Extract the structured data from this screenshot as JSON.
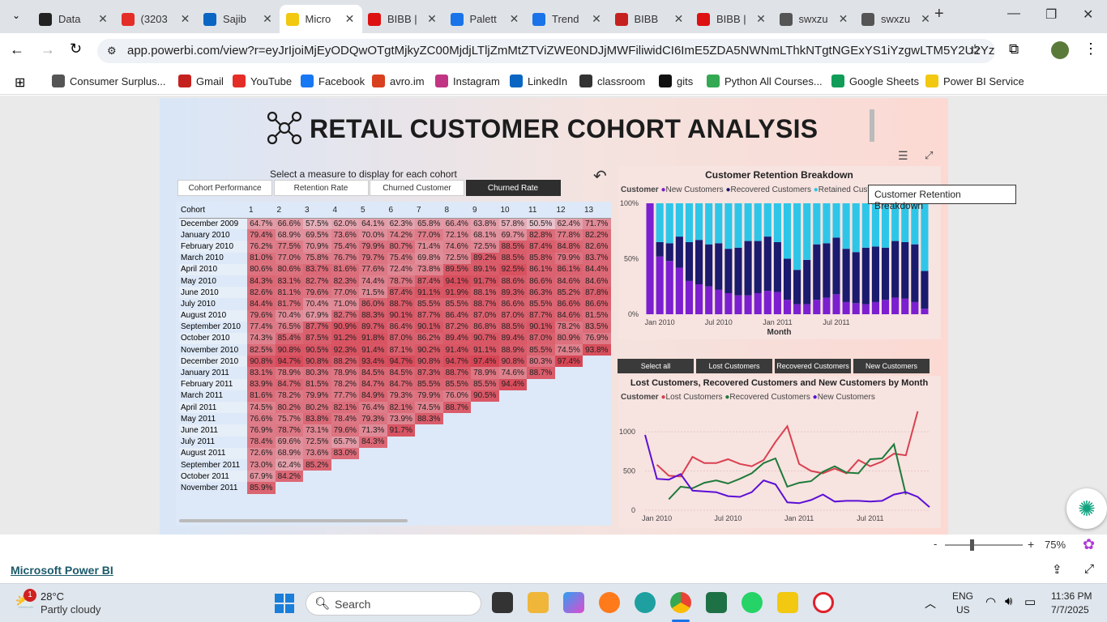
{
  "browser": {
    "tabs": [
      {
        "label": "Data",
        "color": "#222"
      },
      {
        "label": "(3203",
        "color": "#e52d27"
      },
      {
        "label": "Sajib",
        "color": "#0a66c2"
      },
      {
        "label": "Micro",
        "color": "#f2c811"
      },
      {
        "label": "BIBB |",
        "color": "#d11"
      },
      {
        "label": "Palett",
        "color": "#1a73e8"
      },
      {
        "label": "Trend",
        "color": "#1a73e8"
      },
      {
        "label": "BIBB",
        "color": "#c5221f"
      },
      {
        "label": "BIBB |",
        "color": "#d11"
      },
      {
        "label": "swxzu",
        "color": "#555"
      },
      {
        "label": "swxzu",
        "color": "#555"
      }
    ],
    "url": "app.powerbi.com/view?r=eyJrIjoiMjEyODQwOTgtMjkyZC00MjdjLTljZmMtZTViZWE0NDJjMWFiliwidCI6ImE5ZDA5NWNmLThkNTgtNGExYS1iYzgwLTM5Y2U2YzNjMGNj...",
    "bookmarks": [
      {
        "label": "Consumer Surplus...",
        "color": "#555"
      },
      {
        "label": "Gmail",
        "color": "#c5221f"
      },
      {
        "label": "YouTube",
        "color": "#e52d27"
      },
      {
        "label": "Facebook",
        "color": "#1877f2"
      },
      {
        "label": "avro.im",
        "color": "#d9401f"
      },
      {
        "label": "Instagram",
        "color": "#c13584"
      },
      {
        "label": "LinkedIn",
        "color": "#0a66c2"
      },
      {
        "label": "classroom",
        "color": "#333"
      },
      {
        "label": "gits",
        "color": "#111"
      },
      {
        "label": "Python All Courses...",
        "color": "#34a853"
      },
      {
        "label": "Google Sheets",
        "color": "#0f9d58"
      },
      {
        "label": "Power BI Service",
        "color": "#f2c811"
      }
    ]
  },
  "report": {
    "title": "RETAIL CUSTOMER COHORT ANALYSIS",
    "measure_prompt": "Select a measure to display for each cohort",
    "measure_buttons": [
      "Cohort Performance",
      "Retention Rate",
      "Churned Customer",
      "Churned Rate"
    ],
    "selected_measure": "Churned Rate",
    "cohort_header": "Cohort",
    "month_headers": [
      "1",
      "2",
      "3",
      "4",
      "5",
      "6",
      "7",
      "8",
      "9",
      "10",
      "11",
      "12",
      "13"
    ],
    "cohorts": [
      {
        "name": "December 2009",
        "values": [
          "64.7%",
          "66.6%",
          "57.5%",
          "62.0%",
          "64.1%",
          "62.3%",
          "65.8%",
          "66.4%",
          "63.8%",
          "57.8%",
          "50.5%",
          "62.4%",
          "71.7%"
        ]
      },
      {
        "name": "January 2010",
        "values": [
          "79.4%",
          "68.9%",
          "69.5%",
          "73.6%",
          "70.0%",
          "74.2%",
          "77.0%",
          "72.1%",
          "68.1%",
          "69.7%",
          "82.8%",
          "77.8%",
          "82.2%"
        ]
      },
      {
        "name": "February 2010",
        "values": [
          "76.2%",
          "77.5%",
          "70.9%",
          "75.4%",
          "79.9%",
          "80.7%",
          "71.4%",
          "74.6%",
          "72.5%",
          "88.5%",
          "87.4%",
          "84.8%",
          "82.6%"
        ]
      },
      {
        "name": "March 2010",
        "values": [
          "81.0%",
          "77.0%",
          "75.8%",
          "76.7%",
          "79.7%",
          "75.4%",
          "69.8%",
          "72.5%",
          "89.2%",
          "88.5%",
          "85.8%",
          "79.9%",
          "83.7%"
        ]
      },
      {
        "name": "April 2010",
        "values": [
          "80.6%",
          "80.6%",
          "83.7%",
          "81.6%",
          "77.6%",
          "72.4%",
          "73.8%",
          "89.5%",
          "89.1%",
          "92.5%",
          "86.1%",
          "86.1%",
          "84.4%"
        ]
      },
      {
        "name": "May 2010",
        "values": [
          "84.3%",
          "83.1%",
          "82.7%",
          "82.3%",
          "74.4%",
          "78.7%",
          "87.4%",
          "94.1%",
          "91.7%",
          "88.6%",
          "86.6%",
          "84.6%",
          "84.6%"
        ]
      },
      {
        "name": "June 2010",
        "values": [
          "82.6%",
          "81.1%",
          "79.6%",
          "77.0%",
          "71.5%",
          "87.4%",
          "91.1%",
          "91.9%",
          "88.1%",
          "89.3%",
          "86.3%",
          "85.2%",
          "87.8%"
        ]
      },
      {
        "name": "July 2010",
        "values": [
          "84.4%",
          "81.7%",
          "70.4%",
          "71.0%",
          "86.0%",
          "88.7%",
          "85.5%",
          "85.5%",
          "88.7%",
          "86.6%",
          "85.5%",
          "86.6%",
          "86.6%"
        ]
      },
      {
        "name": "August 2010",
        "values": [
          "79.6%",
          "70.4%",
          "67.9%",
          "82.7%",
          "88.3%",
          "90.1%",
          "87.7%",
          "86.4%",
          "87.0%",
          "87.0%",
          "87.7%",
          "84.6%",
          "81.5%"
        ]
      },
      {
        "name": "September 2010",
        "values": [
          "77.4%",
          "76.5%",
          "87.7%",
          "90.9%",
          "89.7%",
          "86.4%",
          "90.1%",
          "87.2%",
          "86.8%",
          "88.5%",
          "90.1%",
          "78.2%",
          "83.5%"
        ]
      },
      {
        "name": "October 2010",
        "values": [
          "74.3%",
          "85.4%",
          "87.5%",
          "91.2%",
          "91.8%",
          "87.0%",
          "86.2%",
          "89.4%",
          "90.7%",
          "89.4%",
          "87.0%",
          "80.9%",
          "76.9%"
        ]
      },
      {
        "name": "November 2010",
        "values": [
          "82.5%",
          "90.8%",
          "90.5%",
          "92.3%",
          "91.4%",
          "87.1%",
          "90.2%",
          "91.4%",
          "91.1%",
          "88.9%",
          "85.5%",
          "74.5%",
          "93.8%"
        ]
      },
      {
        "name": "December 2010",
        "values": [
          "90.8%",
          "94.7%",
          "90.8%",
          "88.2%",
          "93.4%",
          "94.7%",
          "90.8%",
          "94.7%",
          "97.4%",
          "90.8%",
          "80.3%",
          "97.4%",
          ""
        ]
      },
      {
        "name": "January 2011",
        "values": [
          "83.1%",
          "78.9%",
          "80.3%",
          "78.9%",
          "84.5%",
          "84.5%",
          "87.3%",
          "88.7%",
          "78.9%",
          "74.6%",
          "88.7%",
          "",
          ""
        ]
      },
      {
        "name": "February 2011",
        "values": [
          "83.9%",
          "84.7%",
          "81.5%",
          "78.2%",
          "84.7%",
          "84.7%",
          "85.5%",
          "85.5%",
          "85.5%",
          "94.4%",
          "",
          "",
          ""
        ]
      },
      {
        "name": "March 2011",
        "values": [
          "81.6%",
          "78.2%",
          "79.9%",
          "77.7%",
          "84.9%",
          "79.3%",
          "79.9%",
          "76.0%",
          "90.5%",
          "",
          "",
          "",
          ""
        ]
      },
      {
        "name": "April 2011",
        "values": [
          "74.5%",
          "80.2%",
          "80.2%",
          "82.1%",
          "76.4%",
          "82.1%",
          "74.5%",
          "88.7%",
          "",
          "",
          "",
          "",
          ""
        ]
      },
      {
        "name": "May 2011",
        "values": [
          "76.6%",
          "75.7%",
          "83.8%",
          "78.4%",
          "79.3%",
          "73.9%",
          "88.3%",
          "",
          "",
          "",
          "",
          "",
          ""
        ]
      },
      {
        "name": "June 2011",
        "values": [
          "76.9%",
          "78.7%",
          "73.1%",
          "79.6%",
          "71.3%",
          "91.7%",
          "",
          "",
          "",
          "",
          "",
          "",
          ""
        ]
      },
      {
        "name": "July 2011",
        "values": [
          "78.4%",
          "69.6%",
          "72.5%",
          "65.7%",
          "84.3%",
          "",
          "",
          "",
          "",
          "",
          "",
          "",
          ""
        ]
      },
      {
        "name": "August 2011",
        "values": [
          "72.6%",
          "68.9%",
          "73.6%",
          "83.0%",
          "",
          "",
          "",
          "",
          "",
          "",
          "",
          "",
          ""
        ]
      },
      {
        "name": "September 2011",
        "values": [
          "73.0%",
          "62.4%",
          "85.2%",
          "",
          "",
          "",
          "",
          "",
          "",
          "",
          "",
          "",
          ""
        ]
      },
      {
        "name": "October 2011",
        "values": [
          "67.9%",
          "84.2%",
          "",
          "",
          "",
          "",
          "",
          "",
          "",
          "",
          "",
          "",
          ""
        ]
      },
      {
        "name": "November 2011",
        "values": [
          "85.9%",
          "",
          "",
          "",
          "",
          "",
          "",
          "",
          "",
          "",
          "",
          "",
          ""
        ]
      }
    ],
    "segment_buttons": [
      "Select all",
      "Lost Customers",
      "Recovered Customers",
      "New Customers"
    ],
    "tooltip": "Customer Retention Breakdown"
  },
  "chart_data": [
    {
      "type": "bar",
      "stacked": true,
      "title": "Customer Retention Breakdown",
      "legend_title": "Customer",
      "xlabel": "Month",
      "ylabel": "",
      "ylim": [
        0,
        100
      ],
      "y_ticks": [
        "0%",
        "50%",
        "100%"
      ],
      "x_ticks": [
        "Jan 2010",
        "Jul 2010",
        "Jan 2011",
        "Jul 2011"
      ],
      "colors": {
        "new": "#7b1fd0",
        "recovered": "#1a1a6e",
        "retained": "#2ec6e8"
      },
      "series": [
        {
          "name": "New Customers",
          "values": [
            100,
            52,
            48,
            42,
            30,
            27,
            25,
            22,
            19,
            17,
            17,
            19,
            21,
            20,
            13,
            9,
            9,
            13,
            15,
            18,
            11,
            10,
            9,
            11,
            13,
            15,
            14,
            11,
            5
          ]
        },
        {
          "name": "Recovered Customers",
          "values": [
            0,
            13,
            16,
            28,
            35,
            40,
            38,
            42,
            40,
            43,
            49,
            47,
            49,
            45,
            37,
            31,
            40,
            50,
            49,
            51,
            48,
            46,
            51,
            50,
            47,
            51,
            51,
            52,
            34
          ]
        },
        {
          "name": "Retained Customers",
          "values": [
            0,
            35,
            36,
            30,
            35,
            33,
            37,
            36,
            41,
            40,
            34,
            34,
            30,
            35,
            50,
            60,
            51,
            37,
            36,
            31,
            41,
            44,
            40,
            39,
            40,
            34,
            35,
            37,
            61
          ]
        }
      ]
    },
    {
      "type": "line",
      "title": "Lost Customers, Recovered Customers and New Customers by Month",
      "legend_title": "Customer",
      "xlabel": "",
      "ylabel": "",
      "ylim": [
        0,
        1300
      ],
      "y_ticks": [
        "0",
        "500",
        "1000"
      ],
      "x_ticks": [
        "Jan 2010",
        "Jul 2010",
        "Jan 2011",
        "Jul 2011"
      ],
      "series": [
        {
          "name": "Lost Customers",
          "color": "#d94050",
          "values": [
            null,
            580,
            440,
            430,
            680,
            600,
            600,
            650,
            590,
            560,
            640,
            870,
            1070,
            590,
            500,
            470,
            530,
            470,
            640,
            560,
            620,
            720,
            700,
            1260
          ]
        },
        {
          "name": "Recovered Customers",
          "color": "#1e7a3a",
          "values": [
            null,
            null,
            140,
            300,
            280,
            350,
            380,
            340,
            400,
            470,
            600,
            660,
            300,
            350,
            370,
            490,
            560,
            480,
            470,
            650,
            660,
            840,
            200,
            null
          ]
        },
        {
          "name": "New Customers",
          "color": "#5b0fd6",
          "values": [
            960,
            400,
            390,
            460,
            250,
            240,
            230,
            180,
            170,
            230,
            380,
            330,
            100,
            90,
            130,
            200,
            110,
            120,
            120,
            110,
            120,
            200,
            230,
            170,
            40
          ]
        }
      ]
    }
  ],
  "powerbi": {
    "brand": "Microsoft Power BI",
    "zoom": "75%"
  },
  "taskbar": {
    "weather_temp": "28°C",
    "weather_desc": "Partly cloudy",
    "search_placeholder": "Search",
    "lang1": "ENG",
    "lang2": "US",
    "time": "11:36 PM",
    "date": "7/7/2025",
    "notif": "1"
  }
}
